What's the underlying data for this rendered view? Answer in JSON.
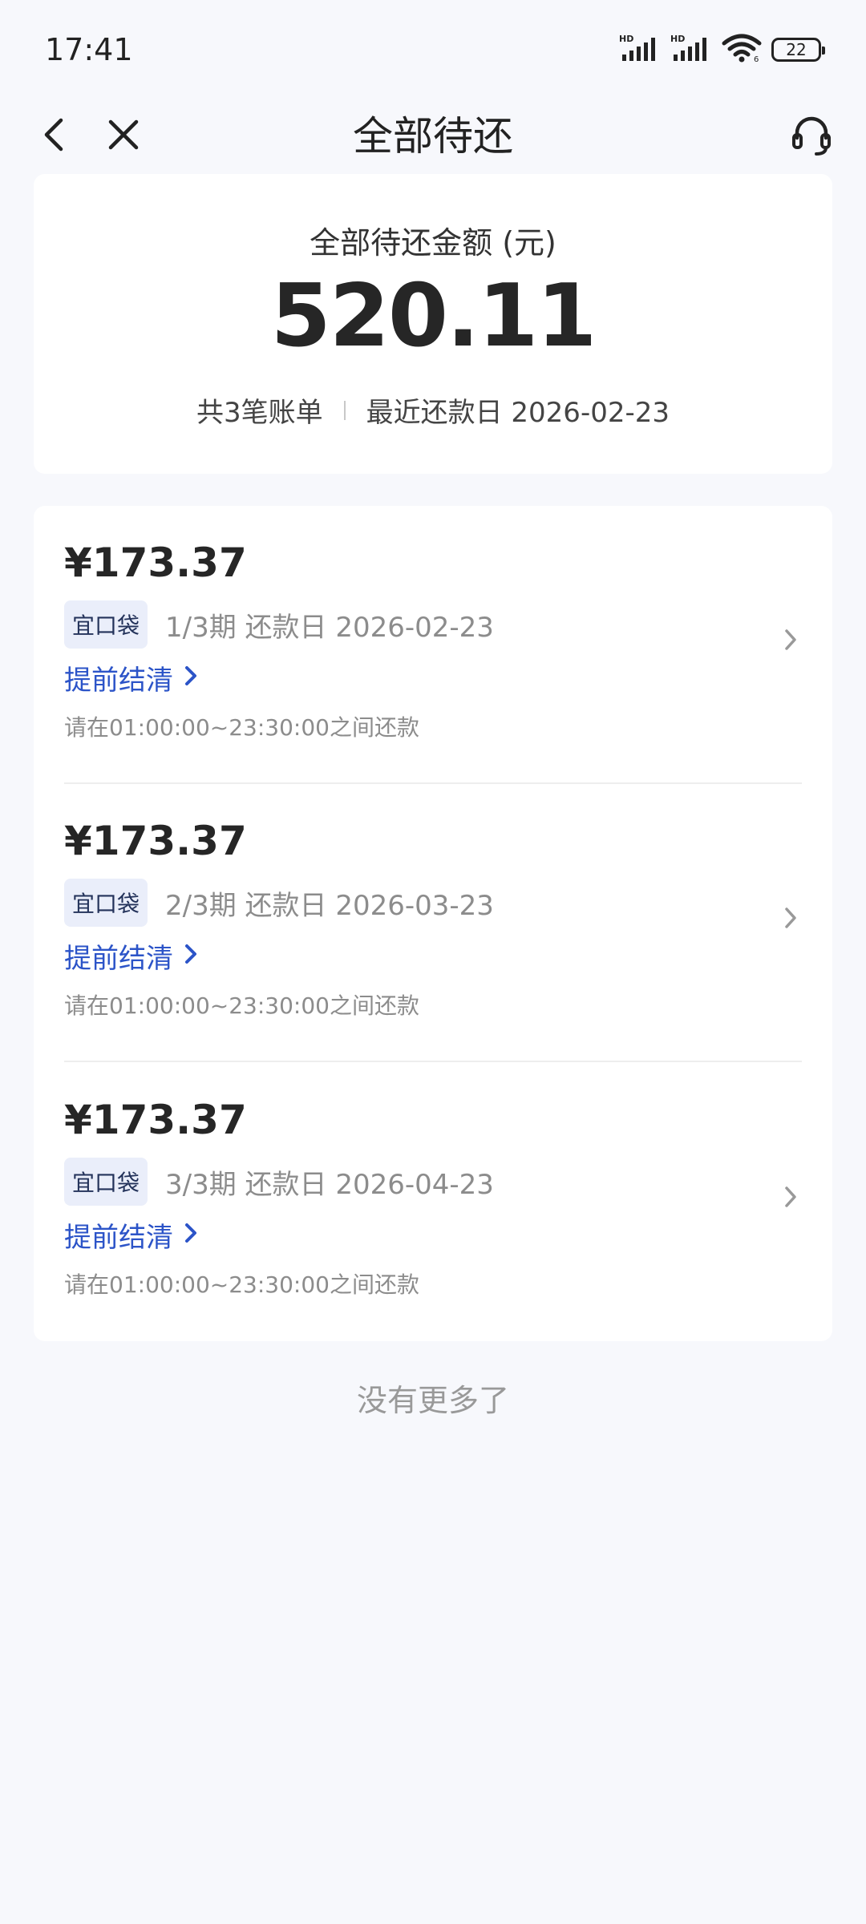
{
  "status_bar": {
    "time": "17:41",
    "battery": "22"
  },
  "nav": {
    "title": "全部待还"
  },
  "summary": {
    "label": "全部待还金额 (元)",
    "amount": "520.11",
    "bill_count": "共3笔账单",
    "next_due": "最近还款日 2026-02-23"
  },
  "bills": [
    {
      "amount": "¥173.37",
      "tag": "宜口袋",
      "period": "1/3期 还款日 2026-02-23",
      "settle_label": "提前结清",
      "note": "请在01:00:00~23:30:00之间还款"
    },
    {
      "amount": "¥173.37",
      "tag": "宜口袋",
      "period": "2/3期 还款日 2026-03-23",
      "settle_label": "提前结清",
      "note": "请在01:00:00~23:30:00之间还款"
    },
    {
      "amount": "¥173.37",
      "tag": "宜口袋",
      "period": "3/3期 还款日 2026-04-23",
      "settle_label": "提前结清",
      "note": "请在01:00:00~23:30:00之间还款"
    }
  ],
  "footer": {
    "no_more": "没有更多了"
  },
  "icons": {
    "back": "chevron-left-icon",
    "close": "close-icon",
    "service": "headset-icon",
    "settle_arrow": "chevron-right-icon",
    "row_arrow": "chevron-right-icon"
  },
  "colors": {
    "background": "#f7f8fc",
    "card": "#ffffff",
    "link": "#2c54c8",
    "tag_bg": "#eaeefa",
    "muted": "#8c8c8c"
  }
}
